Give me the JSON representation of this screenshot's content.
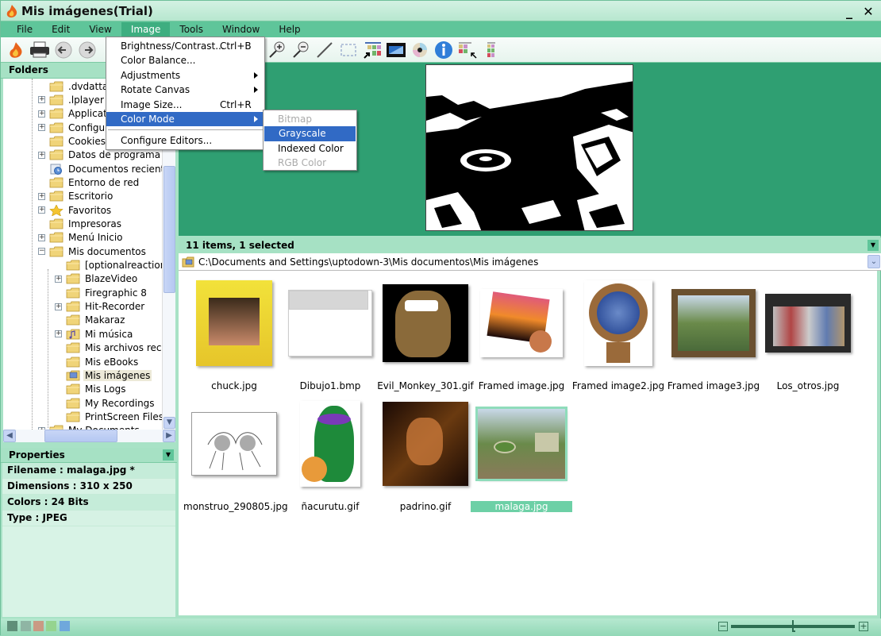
{
  "window": {
    "title": "Mis imágenes(Trial)",
    "minimize_label": "_",
    "close_label": "✕"
  },
  "menubar": [
    {
      "label": "File",
      "key": "F"
    },
    {
      "label": "Edit",
      "key": "E"
    },
    {
      "label": "View",
      "key": "V"
    },
    {
      "label": "Image",
      "key": "I",
      "active": true
    },
    {
      "label": "Tools",
      "key": "T"
    },
    {
      "label": "Window",
      "key": "W"
    },
    {
      "label": "Help",
      "key": "H"
    }
  ],
  "toolbar": {
    "buttons": [
      "app-home",
      "print",
      "back",
      "forward",
      "zoom-in",
      "zoom-out",
      "line-tool",
      "rectangle-select",
      "thumbnails-view",
      "filmstrip-view",
      "cd-burn",
      "info",
      "color-palette-select",
      "color-palette"
    ]
  },
  "image_menu": {
    "items": [
      {
        "label": "Brightness/Contrast...",
        "shortcut": "Ctrl+B"
      },
      {
        "label": "Color Balance...",
        "shortcut": ""
      },
      {
        "label": "Adjustments",
        "submenu": true
      },
      {
        "label": "Rotate Canvas",
        "submenu": true
      },
      {
        "label": "Image Size...",
        "shortcut": "Ctrl+R"
      },
      {
        "label": "Color Mode",
        "submenu": true,
        "highlighted": true
      },
      {
        "label": "Configure Editors...",
        "shortcut": ""
      }
    ]
  },
  "color_mode_submenu": {
    "items": [
      {
        "label": "Bitmap",
        "disabled": true
      },
      {
        "label": "Grayscale",
        "highlighted": true
      },
      {
        "label": "Indexed Color"
      },
      {
        "label": "RGB Color",
        "disabled": true
      }
    ]
  },
  "folders": {
    "header": "Folders",
    "items": [
      {
        "label": ".dvdatta",
        "level": 0,
        "expander": ""
      },
      {
        "label": ".lplayer",
        "level": 0,
        "expander": "+"
      },
      {
        "label": "Applicati",
        "level": 0,
        "expander": "+"
      },
      {
        "label": "Configur",
        "level": 0,
        "expander": "+"
      },
      {
        "label": "Cookies",
        "level": 0,
        "expander": ""
      },
      {
        "label": "Datos de programa",
        "level": 0,
        "expander": "+"
      },
      {
        "label": "Documentos recientes",
        "level": 0,
        "expander": "",
        "icon": "recent"
      },
      {
        "label": "Entorno de red",
        "level": 0,
        "expander": ""
      },
      {
        "label": "Escritorio",
        "level": 0,
        "expander": "+"
      },
      {
        "label": "Favoritos",
        "level": 0,
        "expander": "+",
        "icon": "star"
      },
      {
        "label": "Impresoras",
        "level": 0,
        "expander": ""
      },
      {
        "label": "Menú Inicio",
        "level": 0,
        "expander": "+"
      },
      {
        "label": "Mis documentos",
        "level": 0,
        "expander": "-"
      },
      {
        "label": "[optionalreaction]",
        "level": 1,
        "expander": ""
      },
      {
        "label": "BlazeVideo",
        "level": 1,
        "expander": "+"
      },
      {
        "label": "Firegraphic 8",
        "level": 1,
        "expander": ""
      },
      {
        "label": "Hit-Recorder",
        "level": 1,
        "expander": "+"
      },
      {
        "label": "Makaraz",
        "level": 1,
        "expander": ""
      },
      {
        "label": "Mi música",
        "level": 1,
        "expander": "+",
        "icon": "music"
      },
      {
        "label": "Mis archivos recibi",
        "level": 1,
        "expander": ""
      },
      {
        "label": "Mis eBooks",
        "level": 1,
        "expander": ""
      },
      {
        "label": "Mis imágenes",
        "level": 1,
        "expander": "",
        "icon": "pictures",
        "selected": true
      },
      {
        "label": "Mis Logs",
        "level": 1,
        "expander": ""
      },
      {
        "label": "My Recordings",
        "level": 1,
        "expander": ""
      },
      {
        "label": "PrintScreen Files",
        "level": 1,
        "expander": ""
      },
      {
        "label": "My Documents",
        "level": 0,
        "expander": "+"
      }
    ]
  },
  "properties": {
    "header": "Properties",
    "rows": [
      "Filename : malaga.jpg *",
      "Dimensions : 310 x 250",
      "Colors : 24 Bits",
      "Type : JPEG"
    ]
  },
  "browser": {
    "status": "11 items, 1 selected",
    "path": "C:\\Documents and Settings\\uptodown-3\\Mis documentos\\Mis imágenes",
    "files": [
      {
        "name": "chuck.jpg"
      },
      {
        "name": "Dibujo1.bmp"
      },
      {
        "name": "Evil_Monkey_301.gif"
      },
      {
        "name": "Framed image.jpg"
      },
      {
        "name": "Framed image2.jpg"
      },
      {
        "name": "Framed image3.jpg"
      },
      {
        "name": "Los_otros.jpg"
      },
      {
        "name": "monstruo_290805.jpg"
      },
      {
        "name": "ñacurutu.gif"
      },
      {
        "name": "padrino.gif"
      },
      {
        "name": "malaga.jpg",
        "selected": true
      }
    ]
  },
  "bottombar": {
    "swatches": [
      "#5f8f79",
      "#8fb5a4",
      "#c99a84",
      "#95d48f",
      "#6fa8dc"
    ],
    "zoom_minus": "−",
    "zoom_plus": "+",
    "zoom_level_fraction": 0.5
  },
  "colors": {
    "accent": "#5fc59a",
    "menu_highlight": "#316ac5",
    "preview_bg": "#2f9f72"
  }
}
